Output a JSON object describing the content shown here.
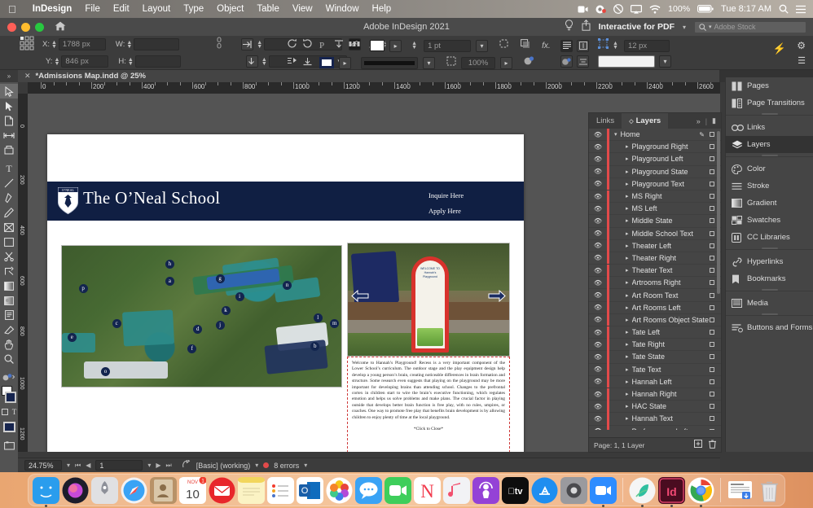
{
  "macbar": {
    "apple_icon": "apple-icon",
    "items": [
      {
        "label": "InDesign",
        "bold": true
      },
      {
        "label": "File",
        "bold": false
      },
      {
        "label": "Edit",
        "bold": false
      },
      {
        "label": "Layout",
        "bold": false
      },
      {
        "label": "Type",
        "bold": false
      },
      {
        "label": "Object",
        "bold": false
      },
      {
        "label": "Table",
        "bold": false
      },
      {
        "label": "View",
        "bold": false
      },
      {
        "label": "Window",
        "bold": false
      },
      {
        "label": "Help",
        "bold": false
      }
    ],
    "status": {
      "battery_percent": "100%",
      "clock": "Tue 8:17 AM",
      "icons": [
        "screen-record-icon",
        "camera-icon",
        "do-not-disturb-icon",
        "airplay-icon",
        "wifi-icon",
        "battery-icon",
        "spotlight-icon",
        "control-center-icon"
      ]
    }
  },
  "titlebar": {
    "app_title": "Adobe InDesign 2021",
    "home_icon": "home-icon",
    "traffic_lights": [
      "close-button",
      "minimize-button",
      "zoom-button"
    ]
  },
  "options_bar": {
    "reference_point": "reference-point-proxy",
    "x_label": "X:",
    "x_value": "1788 px",
    "y_label": "Y:",
    "y_value": "846 px",
    "w_label": "W:",
    "w_value": "",
    "h_label": "H:",
    "h_value": "",
    "constrain_icon": "chain-link-icon",
    "flip_h_icon": "flip-horizontal-icon",
    "flip_v_icon": "flip-vertical-icon",
    "rotate_value": "",
    "shear_value": "",
    "stroke_weight": "1 pt",
    "scale_percent": "100%",
    "corner_size": "12 px",
    "fx_label": "fx.",
    "rotate_cw_icon": "rotate-clockwise-icon",
    "rotate_ccw_icon": "rotate-counterclockwise-icon",
    "fill_swatch_color": "#ffffff",
    "stroke_swatch_color": "#16244e",
    "gear_icon": "gear-icon",
    "lightning_icon": "quick-apply-icon",
    "menu_icon": "panel-menu-icon"
  },
  "app_header": {
    "bulb_icon": "lightbulb-icon",
    "share_icon": "share-icon",
    "workspace": "Interactive for PDF",
    "search_placeholder": "Adobe Stock",
    "search_icon": "search-icon"
  },
  "document_tab": {
    "close_icon": "close-icon",
    "title": "*Admissions Map.indd @ 25%"
  },
  "ruler": {
    "unit": "px",
    "h_ticks": [
      "0",
      "200",
      "400",
      "600",
      "800",
      "1000",
      "1200",
      "1400",
      "1600",
      "1800",
      "2000",
      "2200",
      "2400",
      "2600"
    ],
    "v_ticks": [
      "0",
      "200",
      "400",
      "600",
      "800",
      "1000",
      "1200"
    ]
  },
  "tools": [
    {
      "name": "selection-tool",
      "glyph": "selection",
      "selected": true
    },
    {
      "name": "direct-selection-tool",
      "glyph": "direct",
      "selected": false
    },
    {
      "name": "page-tool",
      "glyph": "page",
      "selected": false
    },
    {
      "name": "gap-tool",
      "glyph": "gap",
      "selected": false
    },
    {
      "name": "content-collector-tool",
      "glyph": "collector",
      "selected": false
    },
    {
      "name": "type-tool",
      "glyph": "T",
      "selected": false
    },
    {
      "name": "line-tool",
      "glyph": "line",
      "selected": false
    },
    {
      "name": "pen-tool",
      "glyph": "pen",
      "selected": false
    },
    {
      "name": "pencil-tool",
      "glyph": "pencil",
      "selected": false
    },
    {
      "name": "frame-tool",
      "glyph": "frame-x",
      "selected": false
    },
    {
      "name": "rectangle-tool",
      "glyph": "rect",
      "selected": false
    },
    {
      "name": "scissors-tool",
      "glyph": "scissors",
      "selected": false
    },
    {
      "name": "free-transform-tool",
      "glyph": "transform",
      "selected": false
    },
    {
      "name": "gradient-swatch-tool",
      "glyph": "gradient",
      "selected": false
    },
    {
      "name": "gradient-feather-tool",
      "glyph": "feather",
      "selected": false
    },
    {
      "name": "note-tool",
      "glyph": "note",
      "selected": false
    },
    {
      "name": "color-theme-tool",
      "glyph": "theme",
      "selected": false
    },
    {
      "name": "hand-tool",
      "glyph": "hand",
      "selected": false
    },
    {
      "name": "zoom-tool",
      "glyph": "zoom",
      "selected": false
    }
  ],
  "page_content": {
    "school_name": "The O’Neal School",
    "crest_text": "O’NEAL",
    "header_links": [
      "Inquire Here",
      "Apply Here"
    ],
    "map": {
      "name": "campus-aerial-map",
      "markers": [
        "p",
        "h",
        "a",
        "g",
        "c",
        "d",
        "f",
        "i",
        "k",
        "j",
        "n",
        "l",
        "m",
        "b",
        "o",
        "e"
      ]
    },
    "photo": {
      "name": "playground-photo",
      "prev_arrow": "previous-arrow-icon",
      "next_arrow": "next-arrow-icon",
      "sign_title": "WELCOME TO Hannah’s Playground"
    },
    "text_box": {
      "body": "Welcome to Hannah’s Playground! Recess is a very important component of the Lower School’s curriculum. The outdoor stage and the play equipment design help develop a young person’s brain, creating noticeable differences in brain formation and structure. Some research even suggests that playing on the playground may be more important for developing brains than attending school. Changes to the prefrontal cortex in children start to wire the brain’s executive functioning, which regulates emotion and helps us solve problems and make plans. The crucial factor in playing outside that develops better brain function is free play, with no rules, umpires, or coaches. One way to promote free play that benefits brain development is by allowing children to enjoy plenty of time at the local playground.",
      "close_label": "*Click to Close*"
    }
  },
  "panel": {
    "tabs": [
      {
        "label": "Links",
        "active": false
      },
      {
        "label": "Layers",
        "active": true
      }
    ],
    "expand_icon": "chevrons-right-icon",
    "menu_icon": "panel-menu-icon",
    "layers": [
      {
        "name": "Home",
        "child": false,
        "pen": true
      },
      {
        "name": "Playground Right",
        "child": true,
        "pen": false
      },
      {
        "name": "Playground Left",
        "child": true,
        "pen": false
      },
      {
        "name": "Playground State",
        "child": true,
        "pen": false
      },
      {
        "name": "Playground Text",
        "child": true,
        "pen": false
      },
      {
        "name": "MS Right",
        "child": true,
        "pen": false
      },
      {
        "name": "MS Left",
        "child": true,
        "pen": false
      },
      {
        "name": "Middle State",
        "child": true,
        "pen": false
      },
      {
        "name": "Middle School Text",
        "child": true,
        "pen": false
      },
      {
        "name": "Theater Left",
        "child": true,
        "pen": false
      },
      {
        "name": "Theater Right",
        "child": true,
        "pen": false
      },
      {
        "name": "Theater Text",
        "child": true,
        "pen": false
      },
      {
        "name": "Artrooms Right",
        "child": true,
        "pen": false
      },
      {
        "name": "Art Room Text",
        "child": true,
        "pen": false
      },
      {
        "name": "Art Rooms Left",
        "child": true,
        "pen": false
      },
      {
        "name": "Art Rooms Object State",
        "child": true,
        "pen": false
      },
      {
        "name": "Tate Left",
        "child": true,
        "pen": false
      },
      {
        "name": "Tate Right",
        "child": true,
        "pen": false
      },
      {
        "name": "Tate State",
        "child": true,
        "pen": false
      },
      {
        "name": "Tate Text",
        "child": true,
        "pen": false
      },
      {
        "name": "Hannah Left",
        "child": true,
        "pen": false
      },
      {
        "name": "Hannah Right",
        "child": true,
        "pen": false
      },
      {
        "name": "HAC State",
        "child": true,
        "pen": false
      },
      {
        "name": "Hannah Text",
        "child": true,
        "pen": false
      },
      {
        "name": "Performance Left",
        "child": true,
        "pen": false
      }
    ],
    "footer": {
      "status": "Page: 1, 1 Layer",
      "new_layer_icon": "new-layer-icon",
      "delete_icon": "trash-icon"
    }
  },
  "dock_right": [
    {
      "label": "Pages",
      "icon": "pages-icon",
      "active": false
    },
    {
      "label": "Page Transitions",
      "icon": "page-transitions-icon",
      "active": false
    },
    {
      "divider": true
    },
    {
      "label": "Links",
      "icon": "links-icon",
      "active": false
    },
    {
      "label": "Layers",
      "icon": "layers-icon",
      "active": true
    },
    {
      "divider": true
    },
    {
      "label": "Color",
      "icon": "color-icon",
      "active": false
    },
    {
      "label": "Stroke",
      "icon": "stroke-icon",
      "active": false
    },
    {
      "label": "Gradient",
      "icon": "gradient-icon",
      "active": false
    },
    {
      "label": "Swatches",
      "icon": "swatches-icon",
      "active": false
    },
    {
      "label": "CC Libraries",
      "icon": "cc-libraries-icon",
      "active": false
    },
    {
      "divider": true
    },
    {
      "label": "Hyperlinks",
      "icon": "hyperlinks-icon",
      "active": false
    },
    {
      "label": "Bookmarks",
      "icon": "bookmarks-icon",
      "active": false
    },
    {
      "divider": true
    },
    {
      "label": "Media",
      "icon": "media-icon",
      "active": false
    },
    {
      "divider": true
    },
    {
      "label": "Buttons and Forms",
      "icon": "buttons-forms-icon",
      "active": false
    }
  ],
  "status_bar": {
    "zoom": "24.75%",
    "page_number": "1",
    "first_icon": "first-page-icon",
    "prev_icon": "previous-page-icon",
    "next_icon": "next-page-icon",
    "last_icon": "last-page-icon",
    "preflight_icon": "preflight-icon",
    "profile": "[Basic] (working)",
    "errors": "8 errors",
    "error_color": "#e24a4a"
  },
  "macos_dock": {
    "items": [
      {
        "name": "finder",
        "color": "#2a9ded",
        "glyph": "finder",
        "running": true
      },
      {
        "name": "siri",
        "color": "#1d1d2b",
        "glyph": "siri",
        "running": false
      },
      {
        "name": "launchpad",
        "color": "#d6d6d6",
        "glyph": "rocket",
        "running": false
      },
      {
        "name": "safari",
        "color": "#3aa3f5",
        "glyph": "compass",
        "running": false
      },
      {
        "name": "contacts",
        "color": "#b89267",
        "glyph": "book",
        "running": false
      },
      {
        "name": "calendar",
        "color": "#ffffff",
        "glyph": "calendar",
        "running": false,
        "badge": "1",
        "month": "NOV",
        "day": "10"
      },
      {
        "name": "mail",
        "color": "#e8262b",
        "glyph": "envelope",
        "running": false
      },
      {
        "name": "notes",
        "color": "#fbf3c4",
        "glyph": "notes",
        "running": false
      },
      {
        "name": "reminders",
        "color": "#ffffff",
        "glyph": "list",
        "running": false
      },
      {
        "name": "outlook",
        "color": "#0f6cbd",
        "glyph": "outlook",
        "running": false
      },
      {
        "name": "photos",
        "color": "#ffffff",
        "glyph": "pinwheel",
        "running": false
      },
      {
        "name": "messages",
        "color": "#3aa3f5",
        "glyph": "chat",
        "running": false
      },
      {
        "name": "facetime",
        "color": "#3ece5b",
        "glyph": "video",
        "running": false
      },
      {
        "name": "news",
        "color": "#ffffff",
        "glyph": "news",
        "running": false
      },
      {
        "name": "music",
        "color": "#f2f2f5",
        "glyph": "note",
        "running": false
      },
      {
        "name": "podcasts",
        "color": "#9442d6",
        "glyph": "podcast",
        "running": false
      },
      {
        "name": "apple-tv",
        "color": "#0d0d0d",
        "glyph": "tv",
        "running": false
      },
      {
        "name": "app-store",
        "color": "#1f8ef0",
        "glyph": "appstore",
        "running": false
      },
      {
        "name": "system-preferences",
        "color": "#8e8e93",
        "glyph": "gear",
        "running": false
      },
      {
        "name": "zoom",
        "color": "#2d8cff",
        "glyph": "videocam",
        "running": true
      },
      {
        "separator": true
      },
      {
        "name": "teal-app",
        "color": "#f2f2f2",
        "glyph": "leaf",
        "running": true
      },
      {
        "name": "adobe-indesign",
        "color": "#4a0c20",
        "glyph": "Id",
        "running": true
      },
      {
        "name": "google-chrome",
        "color": "#ffffff",
        "glyph": "chrome",
        "running": true
      },
      {
        "separator": true
      },
      {
        "name": "downloads-stack",
        "color": "#ffffff",
        "glyph": "stack",
        "running": false
      },
      {
        "name": "trash",
        "color": "#e8e8e8",
        "glyph": "trash",
        "running": false
      }
    ]
  }
}
